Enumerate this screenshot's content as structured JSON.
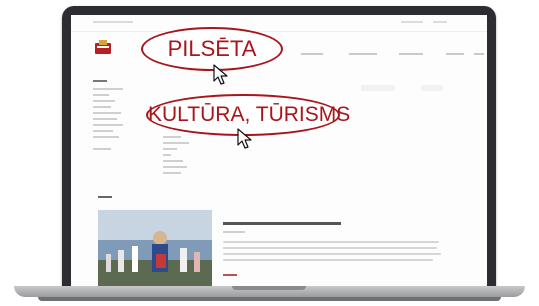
{
  "callouts": {
    "first": "PILSĒTA",
    "second": "KULTŪRA, TŪRISMS"
  },
  "colors": {
    "accent": "#a8161b",
    "laptop_frame": "#2b2d30"
  },
  "icons": [
    "crest-logo-icon",
    "mouse-pointer-icon"
  ]
}
